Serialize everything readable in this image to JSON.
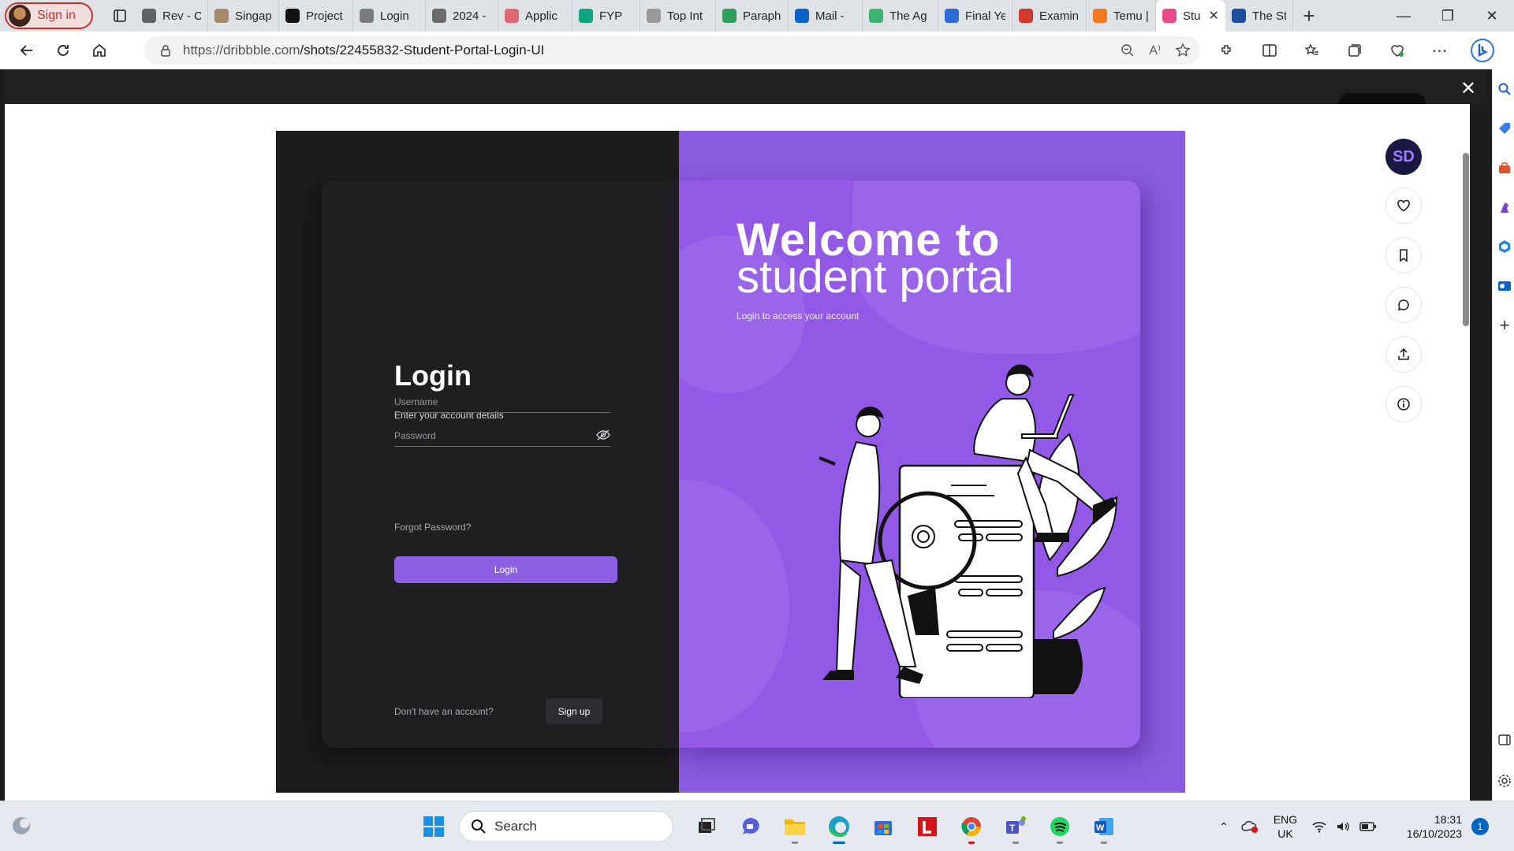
{
  "browser": {
    "profile_label": "Sign in",
    "tabs": [
      {
        "label": "Rev - C",
        "fav_color": "#5f6368"
      },
      {
        "label": "Singap",
        "fav_color": "#a88a6a"
      },
      {
        "label": "Project",
        "fav_color": "#111111"
      },
      {
        "label": "Login",
        "fav_color": "#7a7a7a"
      },
      {
        "label": "2024 -",
        "fav_color": "#6b6b6b"
      },
      {
        "label": "Applic",
        "fav_color": "#e0676f"
      },
      {
        "label": "FYP",
        "fav_color": "#10a37f"
      },
      {
        "label": "Top Int",
        "fav_color": "#999999"
      },
      {
        "label": "Paraph",
        "fav_color": "#2f9e5a"
      },
      {
        "label": "Mail - ",
        "fav_color": "#0a64c8"
      },
      {
        "label": "The Ag",
        "fav_color": "#3cb371"
      },
      {
        "label": "Final Ye",
        "fav_color": "#2b6bd6"
      },
      {
        "label": "Examin",
        "fav_color": "#d13a2f"
      },
      {
        "label": "Temu |",
        "fav_color": "#f57a1f"
      },
      {
        "label": "Stu",
        "fav_color": "#ea4c89"
      },
      {
        "label": "The St",
        "fav_color": "#1b4f9c"
      }
    ],
    "active_tab_index": 14,
    "url_domain": "https://dribbble.com",
    "url_path": "/shots/22455832-Student-Portal-Login-UI"
  },
  "shot": {
    "login_title": "Login",
    "login_subtitle": "Enter your account details",
    "username_placeholder": "Username",
    "password_placeholder": "Password",
    "forgot_password": "Forgot Password?",
    "login_button": "Login",
    "no_account": "Don't have an account?",
    "signup_button": "Sign up",
    "welcome_line1": "Welcome to",
    "welcome_line2": "student portal",
    "welcome_subtitle": "Login to access your account",
    "accent_color": "#8d5fe3"
  },
  "side_actions": {
    "avatar_initials": "SD",
    "icons": [
      "heart-icon",
      "bookmark-icon",
      "comment-icon",
      "share-icon",
      "info-icon"
    ]
  },
  "taskbar": {
    "search_label": "Search",
    "lang_line1": "ENG",
    "lang_line2": "UK",
    "time": "18:31",
    "date": "16/10/2023",
    "notification_count": "1"
  }
}
